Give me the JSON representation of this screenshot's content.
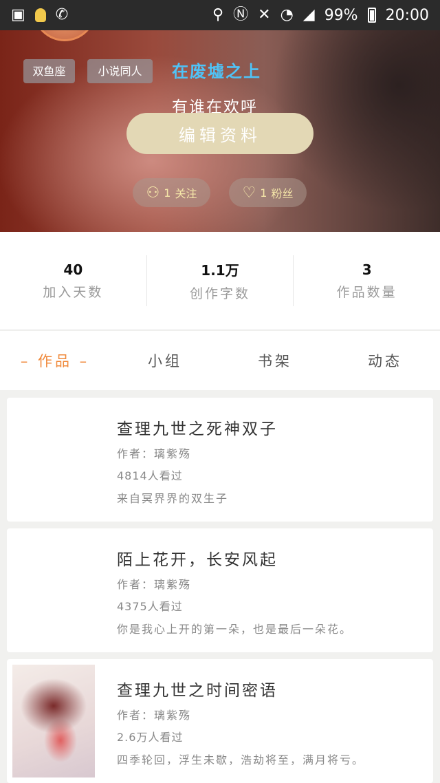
{
  "status_bar": {
    "battery": "99%",
    "time": "20:00",
    "icons": [
      "gallery-icon",
      "bulb-icon",
      "call-forward-icon",
      "location-icon",
      "nfc-icon",
      "mute-icon",
      "wifi-icon",
      "signal-icon",
      "battery-icon"
    ]
  },
  "profile": {
    "tags": [
      "双鱼座",
      "小说同人"
    ],
    "nickname": "在废墟之上",
    "signature": "有谁在欢呼",
    "edit_button": "编辑资料",
    "follow": {
      "count": "1",
      "label": "关注"
    },
    "fans": {
      "count": "1",
      "label": "粉丝"
    }
  },
  "stats": [
    {
      "value": "40",
      "label": "加入天数"
    },
    {
      "value": "1.1万",
      "label": "创作字数"
    },
    {
      "value": "3",
      "label": "作品数量"
    }
  ],
  "tabs": [
    {
      "label": "– 作品 –",
      "active": true
    },
    {
      "label": "小组",
      "active": false
    },
    {
      "label": "书架",
      "active": false
    },
    {
      "label": "动态",
      "active": false
    }
  ],
  "works": [
    {
      "title": "查理九世之死神双子",
      "author": "作者：璃紫殇",
      "views": "4814人看过",
      "desc": "来自冥界界的双生子"
    },
    {
      "title": "陌上花开，长安风起",
      "author": "作者：璃紫殇",
      "views": "4375人看过",
      "desc": "你是我心上开的第一朵，也是最后一朵花。"
    },
    {
      "title": "查理九世之时间密语",
      "author": "作者：璃紫殇",
      "views": "2.6万人看过",
      "desc": "四季轮回，浮生未歇，浩劫将至，满月将亏。"
    }
  ],
  "colors": {
    "accent": "#f08a3c",
    "nickname": "#4fc3f7",
    "edit_button_bg": "#e3d8b5",
    "pill_text": "#f5e6a8"
  }
}
